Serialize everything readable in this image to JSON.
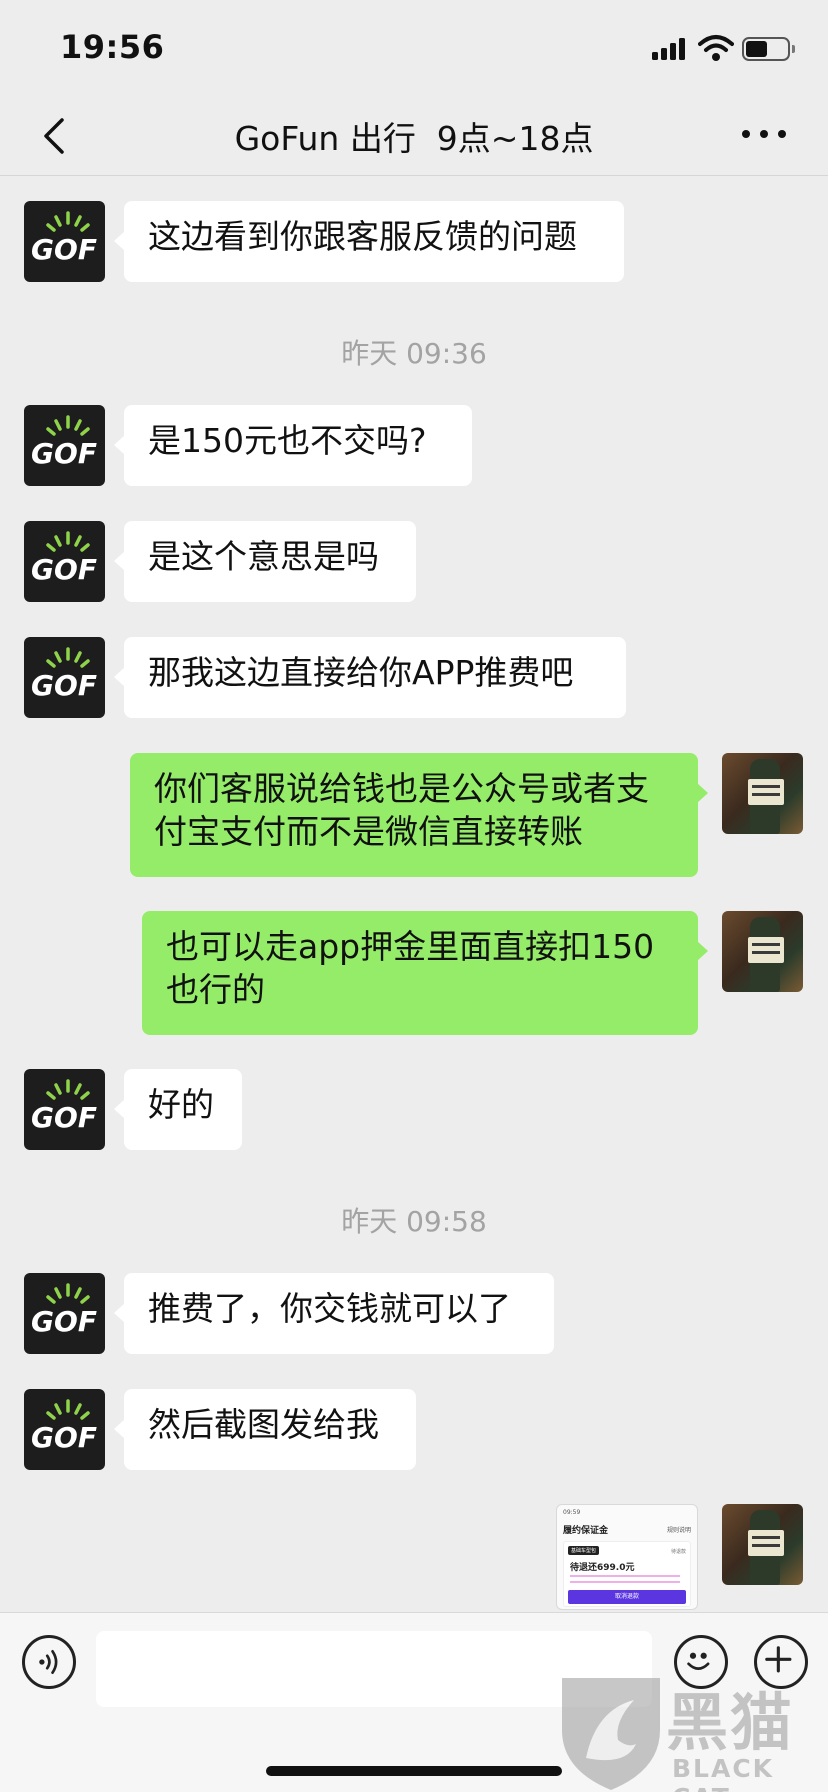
{
  "status_bar": {
    "time": "19:56",
    "battery_level": 0.47
  },
  "nav": {
    "title": "GoFun 出行  9点~18点"
  },
  "avatars": {
    "gof_text": "GOF"
  },
  "messages": [
    {
      "side": "in",
      "text": "这边看到你跟客服反馈的问题"
    },
    {
      "side": "in",
      "text": "是150元也不交吗?"
    },
    {
      "side": "in",
      "text": "是这个意思是吗"
    },
    {
      "side": "in",
      "text": "那我这边直接给你APP推费吧"
    },
    {
      "side": "out",
      "text": "你们客服说给钱也是公众号或者支付宝支付而不是微信直接转账"
    },
    {
      "side": "out",
      "text": "也可以走app押金里面直接扣150也行的"
    },
    {
      "side": "in",
      "text": "好的"
    },
    {
      "side": "in",
      "text": "推费了，你交钱就可以了"
    },
    {
      "side": "in",
      "text": "然后截图发给我"
    }
  ],
  "timestamps": [
    "昨天 09:36",
    "昨天 09:58"
  ],
  "image_message": {
    "status_time": "09:59",
    "title": "履约保证金",
    "help": "规则说明",
    "tag": "基础车型包",
    "card_status": "待退款",
    "amount": "待退还699.0元",
    "button": "取消退款"
  },
  "input": {
    "value": "",
    "placeholder": ""
  },
  "watermark": {
    "cn": "黑猫",
    "en": "BLACK CAT"
  }
}
